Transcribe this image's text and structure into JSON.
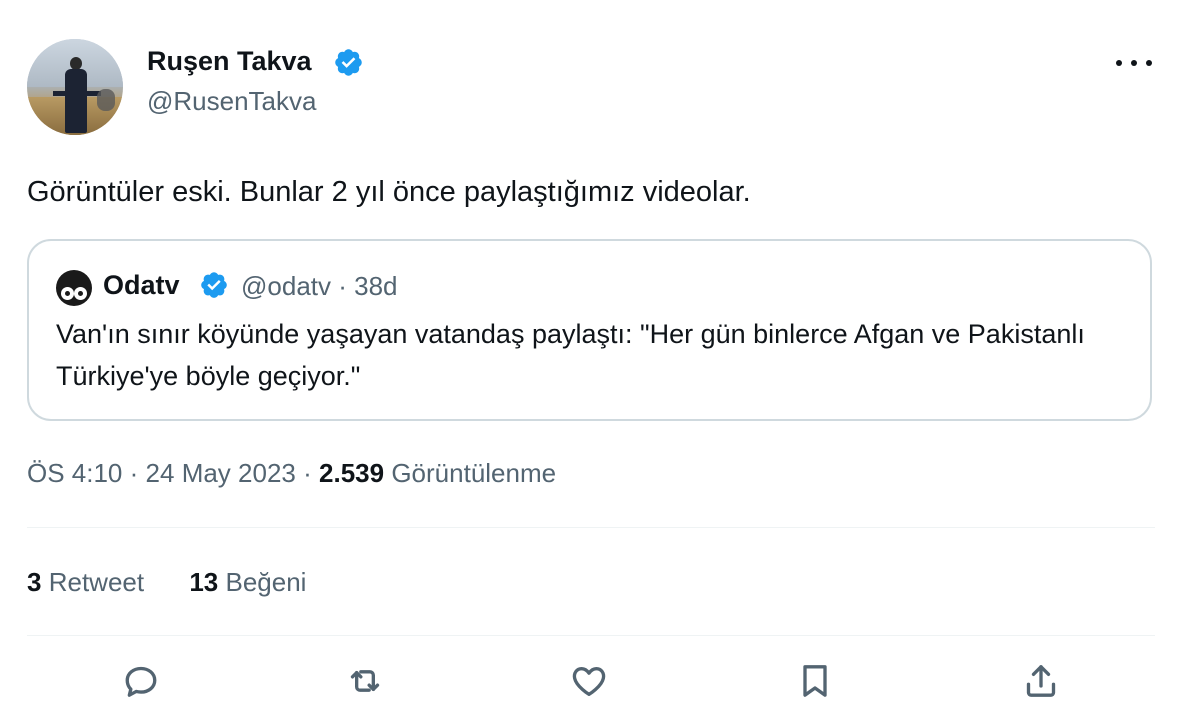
{
  "author": {
    "name": "Ruşen Takva",
    "handle": "@RusenTakva"
  },
  "tweet": {
    "text": "Görüntüler eski. Bunlar 2 yıl önce paylaştığımız videolar."
  },
  "quote": {
    "name": "Odatv",
    "handle": "@odatv",
    "separator": "·",
    "age": "38d",
    "text": "Van'ın sınır köyünde yaşayan vatandaş paylaştı: \"Her gün binlerce Afgan ve Pakistanlı Türkiye'ye böyle geçiyor.\""
  },
  "meta": {
    "time": "ÖS 4:10",
    "sep1": "·",
    "date": "24 May 2023",
    "sep2": "·",
    "views_count": "2.539",
    "views_label": "Görüntülenme"
  },
  "stats": {
    "retweets_count": "3",
    "retweets_label": "Retweet",
    "likes_count": "13",
    "likes_label": "Beğeni"
  },
  "icons": {
    "verified": "verified-badge-icon",
    "more": "more-options-icon",
    "reply": "reply-icon",
    "retweet": "retweet-icon",
    "like": "heart-icon",
    "bookmark": "bookmark-icon",
    "share": "share-icon"
  },
  "colors": {
    "verified_blue": "#1d9bf0",
    "secondary_text": "#536471",
    "primary_text": "#0f1419",
    "border": "#cfd9de"
  }
}
